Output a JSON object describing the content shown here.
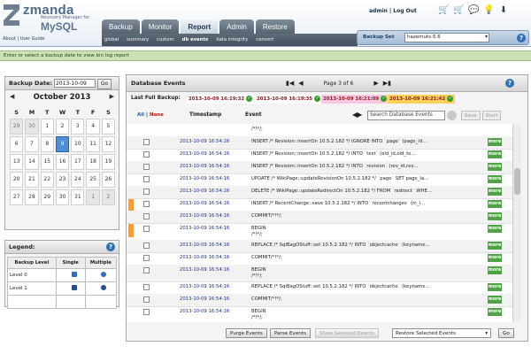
{
  "header": {
    "logo_title": "zmanda",
    "logo_subtitle": "Recovery Manager",
    "logo_for": "for",
    "logo_product": "MySQL",
    "about_links": "About | User Guide",
    "user_links": "admin  |  Log Out",
    "tabs": [
      {
        "label": "Backup",
        "active": false
      },
      {
        "label": "Monitor",
        "active": false
      },
      {
        "label": "Report",
        "active": true
      },
      {
        "label": "Admin",
        "active": false
      },
      {
        "label": "Restore",
        "active": false
      }
    ],
    "subnav": [
      {
        "label": "global",
        "active": false
      },
      {
        "label": "summary",
        "active": false
      },
      {
        "label": "custom",
        "active": false
      },
      {
        "label": "db events",
        "active": true
      },
      {
        "label": "data integrity",
        "active": false
      },
      {
        "label": "convert",
        "active": false
      }
    ],
    "icons": [
      "cart-icon",
      "cart-icon",
      "chat-icon",
      "lightbulb-icon",
      "download-icon"
    ],
    "backup_set_label": "Backup Set",
    "backup_set_value": "hazemuts-5.6"
  },
  "info_message": "Enter or select a backup date to view bin log report",
  "calendar": {
    "label": "Backup Date:",
    "date_value": "2013-10-09",
    "go_label": "Go",
    "month": "October 2013",
    "weekdays": [
      "S",
      "M",
      "T",
      "W",
      "T",
      "F",
      "S"
    ],
    "days": [
      {
        "d": "29",
        "other": true
      },
      {
        "d": "30",
        "other": true
      },
      {
        "d": "1"
      },
      {
        "d": "2"
      },
      {
        "d": "3"
      },
      {
        "d": "4"
      },
      {
        "d": "5"
      },
      {
        "d": "6"
      },
      {
        "d": "7"
      },
      {
        "d": "8"
      },
      {
        "d": "9",
        "selected": true
      },
      {
        "d": "10"
      },
      {
        "d": "11"
      },
      {
        "d": "12"
      },
      {
        "d": "13"
      },
      {
        "d": "14"
      },
      {
        "d": "15"
      },
      {
        "d": "16"
      },
      {
        "d": "17"
      },
      {
        "d": "18"
      },
      {
        "d": "19"
      },
      {
        "d": "20"
      },
      {
        "d": "21"
      },
      {
        "d": "22"
      },
      {
        "d": "23"
      },
      {
        "d": "24"
      },
      {
        "d": "25"
      },
      {
        "d": "26"
      },
      {
        "d": "27"
      },
      {
        "d": "28"
      },
      {
        "d": "29"
      },
      {
        "d": "30"
      },
      {
        "d": "31"
      },
      {
        "d": "1",
        "other": true
      },
      {
        "d": "2",
        "other": true
      }
    ]
  },
  "legend": {
    "title": "Legend:",
    "headers": [
      "Backup Level",
      "Single",
      "Multiple"
    ],
    "rows": [
      {
        "label": "Level 0",
        "single_color": "#2f6fc1",
        "multiple_color": "#2f6fc1"
      },
      {
        "label": "Level 1",
        "single_color": "#1f4f9a",
        "multiple_color": "#1f4f9a"
      }
    ]
  },
  "events": {
    "title": "Database Events",
    "page_text": "Page 3 of 6",
    "last_full_backup_label": "Last Full Backup:",
    "backups": [
      {
        "ts": "2013-10-09 16:19:32",
        "bg": "#ffffff"
      },
      {
        "ts": "2013-10-09 16:19:35",
        "bg": "#ffffff"
      },
      {
        "ts": "2013-10-09 16:21:09",
        "bg": "#f7c8df"
      },
      {
        "ts": "2013-10-09 16:21:42",
        "bg": "#ffd257"
      }
    ],
    "col_all": "All",
    "col_none": "None",
    "col_timestamp": "Timestamp",
    "col_event": "Event",
    "search_placeholder": "Search Database Events",
    "btn_save": "Save",
    "btn_start": "Start",
    "rows": [
      {
        "ts": "",
        "text": "/*!*/;",
        "check": false,
        "more": false
      },
      {
        "ts": "2013-10-09 16:54:16",
        "text": "INSERT /* Revision::insertOn 10.5.2.182 */ IGNORE INTO `page` (page_id...",
        "check": true,
        "more": true
      },
      {
        "ts": "2013-10-09 16:54:16",
        "text": "INSERT /* Revision::insertOn 10.5.2.182 */ INTO `text` (old_id,old_te...",
        "check": true,
        "more": true
      },
      {
        "ts": "2013-10-09 16:54:16",
        "text": "INSERT /* Revision::insertOn 10.5.2.182 */ INTO `revision` (rev_id,rev...",
        "check": true,
        "more": true
      },
      {
        "ts": "2013-10-09 16:54:16",
        "text": "UPDATE /* WikiPage::updateRevisionOn 10.5.2.182 */ `page` SET page_la...",
        "check": true,
        "more": true
      },
      {
        "ts": "2013-10-09 16:54:16",
        "text": "DELETE /* WikiPage::updateRedirectOn 10.5.2.182 */ FROM `redirect` WHE...",
        "check": true,
        "more": true
      },
      {
        "ts": "2013-10-09 16:54:16",
        "text": "INSERT /* RecentChange::save 10.5.2.182 */ INTO `recentchanges` (rc_i...",
        "check": true,
        "more": true
      },
      {
        "ts": "2013-10-09 16:54:16",
        "text": "COMMIT/*!*/;",
        "check": true,
        "more": true
      },
      {
        "ts": "2013-10-09 16:54:16",
        "text": "BEGIN\n/*!*/;",
        "check": true,
        "more": true
      },
      {
        "ts": "2013-10-09 16:54:16",
        "text": "REPLACE /* SqlBagOStuff::set 10.5.2.182 */ INTO `objectcache` (keyname...",
        "check": true,
        "more": true
      },
      {
        "ts": "2013-10-09 16:54:16",
        "text": "COMMIT/*!*/;",
        "check": true,
        "more": true
      },
      {
        "ts": "2013-10-09 16:54:16",
        "text": "BEGIN\n/*!*/;",
        "check": true,
        "more": true
      },
      {
        "ts": "2013-10-09 16:54:16",
        "text": "REPLACE /* SqlBagOStuff::set 10.5.2.182 */ INTO `objectcache` (keyname...",
        "check": true,
        "more": true
      },
      {
        "ts": "2013-10-09 16:54:16",
        "text": "COMMIT/*!*/;",
        "check": true,
        "more": true
      },
      {
        "ts": "2013-10-09 16:54:16",
        "text": "BEGIN\n/*!*/;",
        "check": true,
        "more": true
      }
    ],
    "more_label": "more",
    "btn_purge": "Purge Events",
    "btn_parse": "Parse Events",
    "btn_show_selected": "Show Selected Events",
    "restore_select": "Restore Selected Events",
    "btn_go": "Go"
  }
}
